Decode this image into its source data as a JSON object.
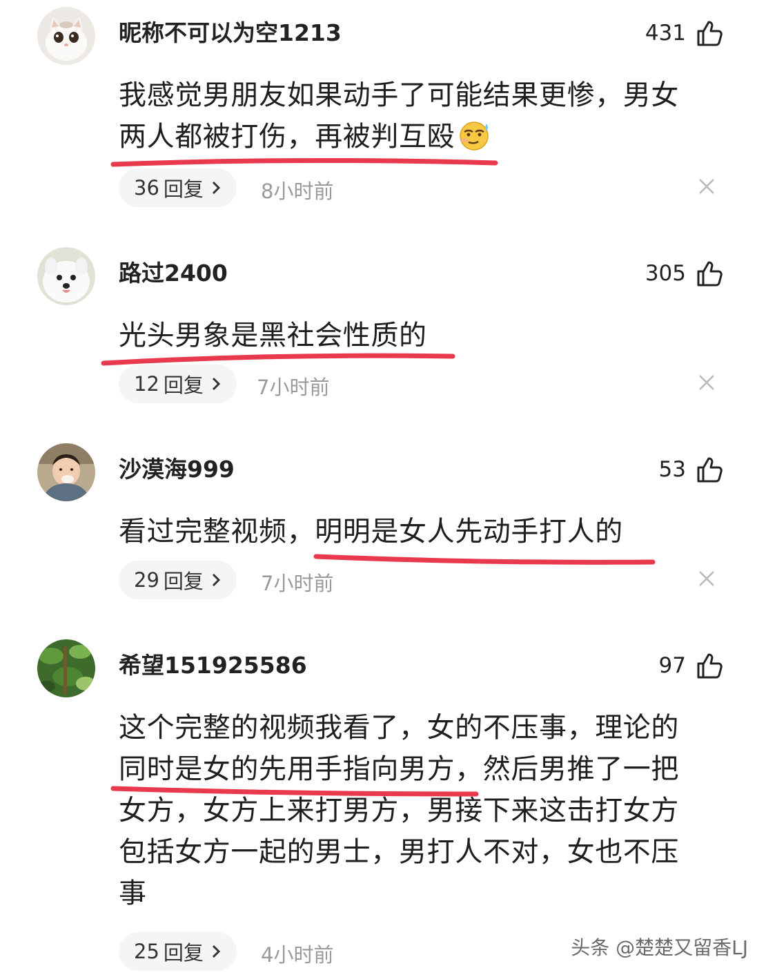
{
  "comments": [
    {
      "username": "昵称不可以为空1213",
      "likes": "431",
      "lines": [
        "我感觉男朋友如果动手了可能结果更惨，男女",
        "两人都被打伤，再被判互殴"
      ],
      "emoji": "sweat-smile-emoji",
      "reply_count": "36",
      "reply_label": "回复",
      "time": "8小时前",
      "avatar": "white-cat"
    },
    {
      "username": "路过2400",
      "likes": "305",
      "lines": [
        "光头男象是黑社会性质的"
      ],
      "reply_count": "12",
      "reply_label": "回复",
      "time": "7小时前",
      "avatar": "white-dog"
    },
    {
      "username": "沙漠海999",
      "likes": "53",
      "lines": [
        "看过完整视频，明明是女人先动手打人的"
      ],
      "reply_count": "29",
      "reply_label": "回复",
      "time": "7小时前",
      "avatar": "child-photo"
    },
    {
      "username": "希望151925586",
      "likes": "97",
      "lines": [
        "这个完整的视频我看了，女的不压事，理论的",
        "同时是女的先用手指向男方，然后男推了一把",
        "女方，女方上来打男方，男接下来这击打女方",
        "包括女方一起的男士，男打人不对，女也不压",
        "事"
      ],
      "reply_count": "25",
      "reply_label": "回复",
      "time": "4小时前",
      "avatar": "green-leaves"
    }
  ],
  "watermark": "头条 @楚楚又留香LJ",
  "colors": {
    "highlight": "#e8394d",
    "pill": "#f4f5f7",
    "muted": "#9a9a9a"
  }
}
